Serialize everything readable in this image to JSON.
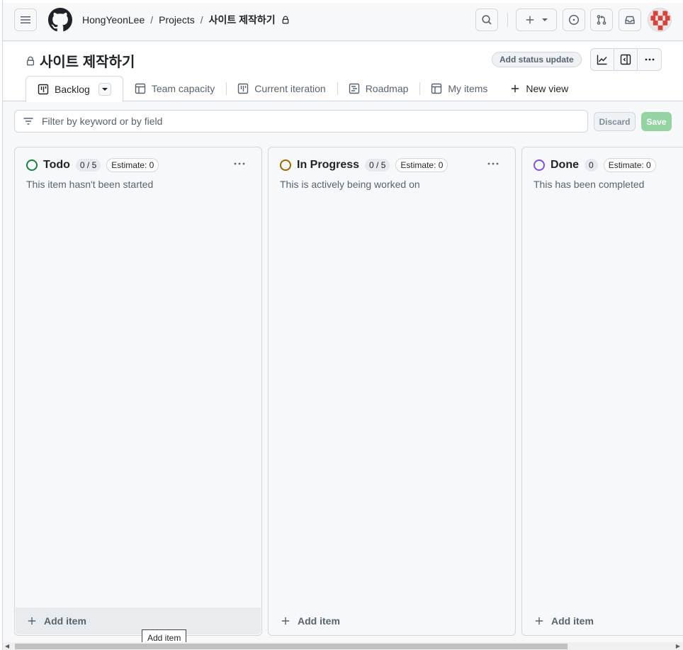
{
  "header": {
    "breadcrumbs": [
      "HongYeonLee",
      "Projects",
      "사이트 제작하기"
    ],
    "separator": "/"
  },
  "project": {
    "title": "사이트 제작하기",
    "status_button": "Add status update"
  },
  "tabs": [
    {
      "label": "Backlog",
      "icon": "board-icon",
      "active": true
    },
    {
      "label": "Team capacity",
      "icon": "table-icon",
      "active": false
    },
    {
      "label": "Current iteration",
      "icon": "board-icon",
      "active": false
    },
    {
      "label": "Roadmap",
      "icon": "roadmap-icon",
      "active": false
    },
    {
      "label": "My items",
      "icon": "table-icon",
      "active": false
    }
  ],
  "new_view_label": "New view",
  "filter": {
    "placeholder": "Filter by keyword or by field",
    "discard_label": "Discard",
    "save_label": "Save"
  },
  "columns": [
    {
      "name": "Todo",
      "count": "0 / 5",
      "estimate": "Estimate: 0",
      "description": "This item hasn't been started",
      "color": "#1a7f37",
      "add_label": "Add item"
    },
    {
      "name": "In Progress",
      "count": "0 / 5",
      "estimate": "Estimate: 0",
      "description": "This is actively being worked on",
      "color": "#9a6700",
      "add_label": "Add item"
    },
    {
      "name": "Done",
      "count": "0",
      "estimate": "Estimate: 0",
      "description": "This has been completed",
      "color": "#8250df",
      "add_label": "Add item"
    }
  ],
  "tooltip": "Add item",
  "colors": {
    "accent_green": "#1f883d",
    "border": "#d0d7de",
    "muted": "#59636e"
  }
}
